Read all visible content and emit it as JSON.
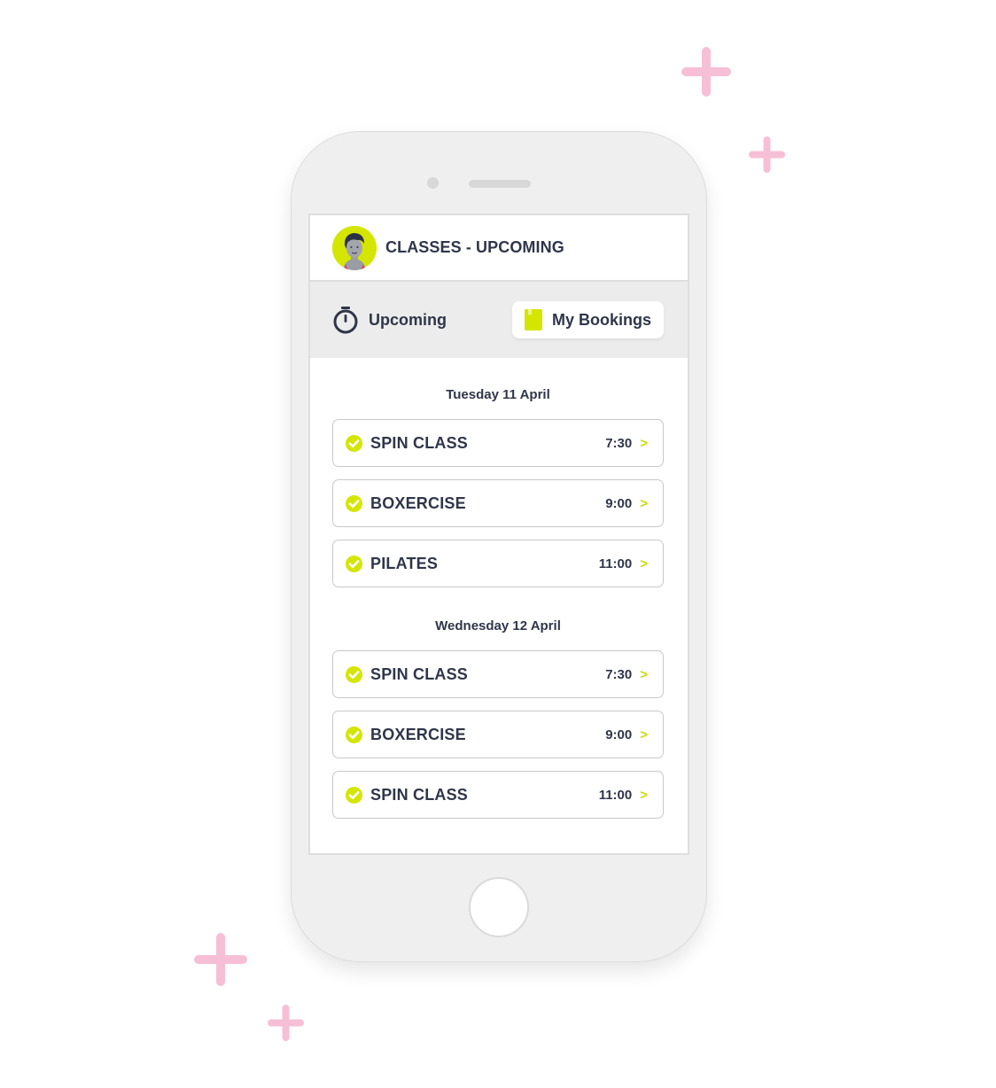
{
  "colors": {
    "accent": "#d4e600",
    "text": "#2f364a",
    "sparkle": "#f7bfd6",
    "phone_body": "#efefef",
    "tab_bar": "#ececec"
  },
  "header": {
    "title": "CLASSES - UPCOMING",
    "avatar_icon": "user-avatar"
  },
  "tabs": [
    {
      "label": "Upcoming",
      "icon": "stopwatch-icon",
      "active": false
    },
    {
      "label": "My Bookings",
      "icon": "bookmark-book-icon",
      "active": true
    }
  ],
  "days": [
    {
      "heading": "Tuesday 11 April",
      "classes": [
        {
          "name": "SPIN CLASS",
          "time": "7:30",
          "chevron": ">",
          "status": "booked"
        },
        {
          "name": "BOXERCISE",
          "time": "9:00",
          "chevron": ">",
          "status": "booked"
        },
        {
          "name": "PILATES",
          "time": "11:00",
          "chevron": ">",
          "status": "booked"
        }
      ]
    },
    {
      "heading": "Wednesday 12 April",
      "classes": [
        {
          "name": "SPIN CLASS",
          "time": "7:30",
          "chevron": ">",
          "status": "booked"
        },
        {
          "name": "BOXERCISE",
          "time": "9:00",
          "chevron": ">",
          "status": "booked"
        },
        {
          "name": "SPIN CLASS",
          "time": "11:00",
          "chevron": ">",
          "status": "booked"
        }
      ]
    }
  ]
}
